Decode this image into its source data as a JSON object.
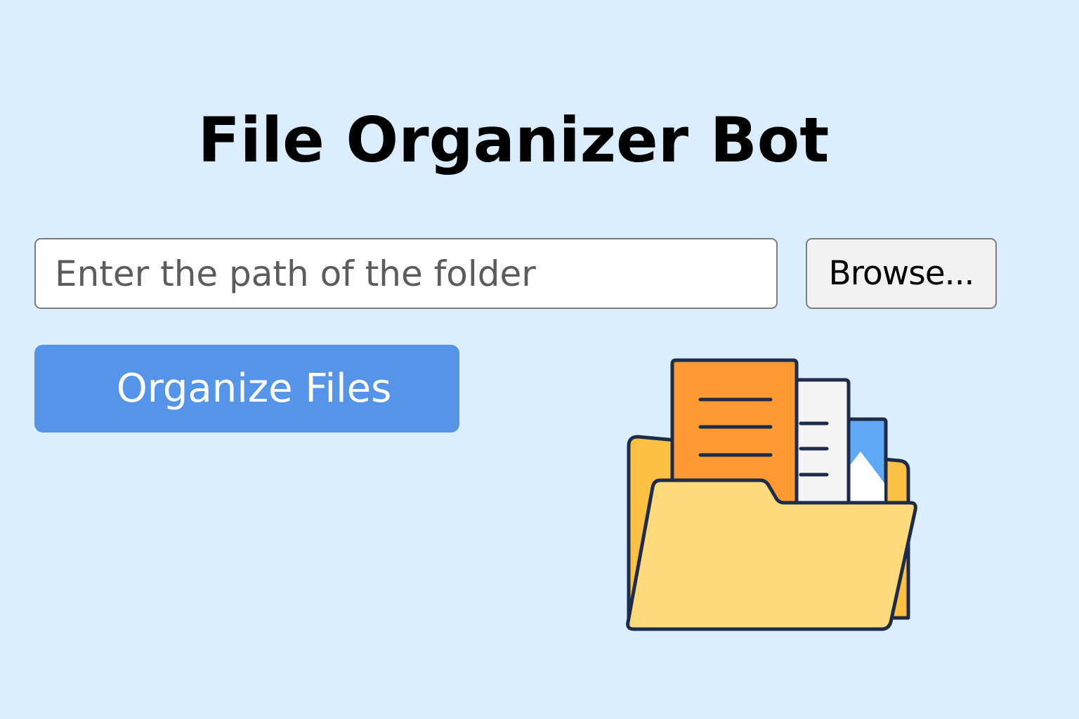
{
  "header": {
    "title": "File Organizer Bot"
  },
  "folder_input": {
    "value": "",
    "placeholder": "Enter the path of the folder"
  },
  "browse_button": {
    "label": "Browse..."
  },
  "organize_button": {
    "label": "Organize Files"
  },
  "illustration": {
    "icon": "open-folder-with-documents-icon"
  },
  "colors": {
    "background": "#DCEEFD",
    "accent_button": "#5594E8",
    "folder_front": "#FDDA7A",
    "folder_back": "#FCC043",
    "document_orange": "#FF9A33",
    "image_blue": "#5EA8F7",
    "outline": "#1E2B4A"
  }
}
